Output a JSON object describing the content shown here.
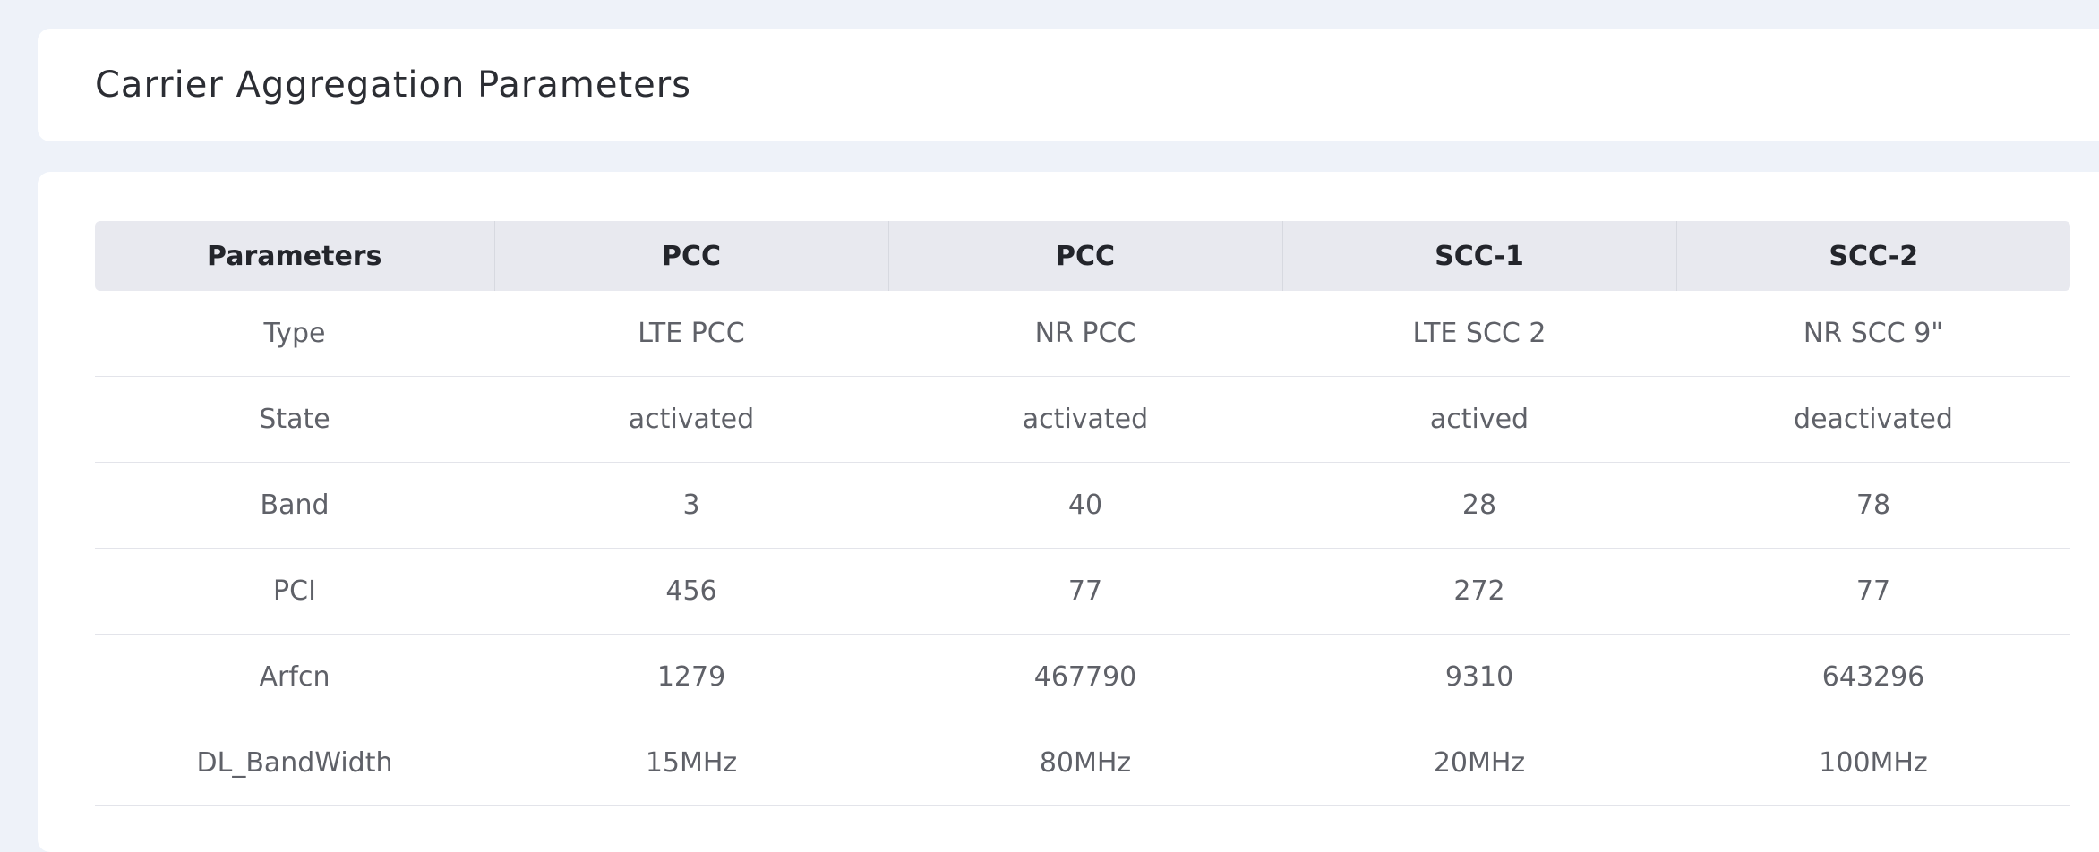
{
  "page": {
    "title": "Carrier Aggregation Parameters"
  },
  "table": {
    "headers": [
      "Parameters",
      "PCC",
      "PCC",
      "SCC-1",
      "SCC-2"
    ],
    "rows": [
      [
        "Type",
        "LTE PCC",
        "NR PCC",
        "LTE SCC 2",
        "NR SCC 9\""
      ],
      [
        "State",
        "activated",
        "activated",
        "actived",
        "deactivated"
      ],
      [
        "Band",
        "3",
        "40",
        "28",
        "78"
      ],
      [
        "PCI",
        "456",
        "77",
        "272",
        "77"
      ],
      [
        "Arfcn",
        "1279",
        "467790",
        "9310",
        "643296"
      ],
      [
        "DL_BandWidth",
        "15MHz",
        "80MHz",
        "20MHz",
        "100MHz"
      ]
    ]
  },
  "colors": {
    "background": "#eef2f9",
    "card": "#ffffff",
    "header_row": "#e8e9ef",
    "title_text": "#2b2d33",
    "cell_text": "#5f6168"
  }
}
